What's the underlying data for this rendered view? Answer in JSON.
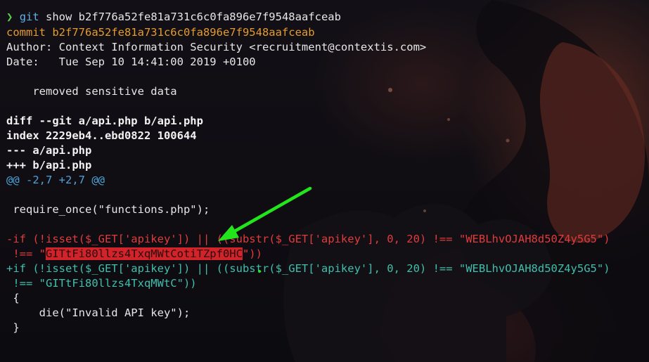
{
  "terminal": {
    "prompt_symbol": "❯",
    "command_git": "git",
    "command_rest": " show b2f776a52fe81a731c6c0fa896e7f9548aafceab",
    "commit_line": "commit b2f776a52fe81a731c6c0fa896e7f9548aafceab",
    "author_line": "Author: Context Information Security <recruitment@contextis.com>",
    "date_line": "Date:   Tue Sep 10 14:41:00 2019 +0100",
    "message_line": "    removed sensitive data",
    "diff_header": "diff --git a/api.php b/api.php",
    "index_line": "index 2229eb4..ebd0822 100644",
    "old_file": "--- a/api.php",
    "new_file": "+++ b/api.php",
    "hunk_header": "@@ -2,7 +2,7 @@",
    "context_require": " require_once(\"functions.php\");",
    "removed_line_1": "-if (!isset($_GET['apikey']) || ((substr($_GET['apikey'], 0, 20) !== \"WEBLhvOJAH8d50Z4y5G5\")",
    "removed_line_2_prefix": " !== \"",
    "removed_line_2_key": "GITtFi80llzs4TxqMWtCotiTZpf0HC",
    "removed_line_2_suffix": "\"))",
    "added_line_1": "+if (!isset($_GET['apikey']) || ((substr($_GET['apikey'], 0, 20) !== \"WEBLhvOJAH8d50Z4y5G5\")",
    "added_line_2": " !== \"GITtFi80llzs4TxqMWtC\"))",
    "brace_open": " {",
    "die_line": "     die(\"Invalid API key\");",
    "brace_close": " }"
  },
  "annotation": {
    "arrow_color": "#22e51c",
    "icon": "arrow-annotation-icon"
  },
  "colors": {
    "prompt": "#55d24a",
    "command": "#5fb0e6",
    "commit": "#e49b2f",
    "hunk": "#4fa3d9",
    "removed": "#e23b3b",
    "added": "#3fbfad",
    "highlight": "#d0232a"
  }
}
